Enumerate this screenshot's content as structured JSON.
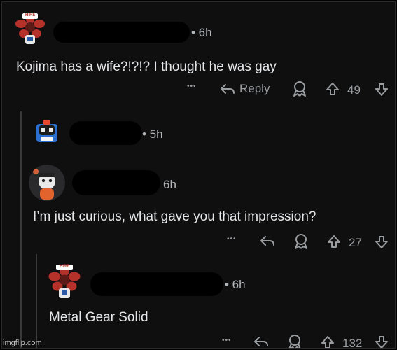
{
  "comments": [
    {
      "time": "• 6h",
      "text": "Kojima has a wife?!?!? I thought he was gay",
      "actions": {
        "more": "•••",
        "reply": "Reply",
        "votes": "49"
      }
    },
    {
      "time": "• 5h"
    },
    {
      "time": "6h",
      "text": "I’m just curious, what gave you that impression?",
      "actions": {
        "more": "•••",
        "votes": "27"
      }
    },
    {
      "time": "• 6h",
      "text": "Metal Gear Solid",
      "actions": {
        "more": "•••",
        "votes": "132"
      }
    }
  ],
  "avatar_badge": "HIRE",
  "watermark": "imgflip.com",
  "colors": {
    "background": "#0f0f10",
    "text": "#e4e6e8",
    "meta": "#9a9da0",
    "thread_line": "#3a3a3d",
    "redaction": "#000000"
  },
  "icons": [
    "more-icon",
    "reply-arrow-icon",
    "award-icon",
    "upvote-icon",
    "downvote-icon"
  ]
}
